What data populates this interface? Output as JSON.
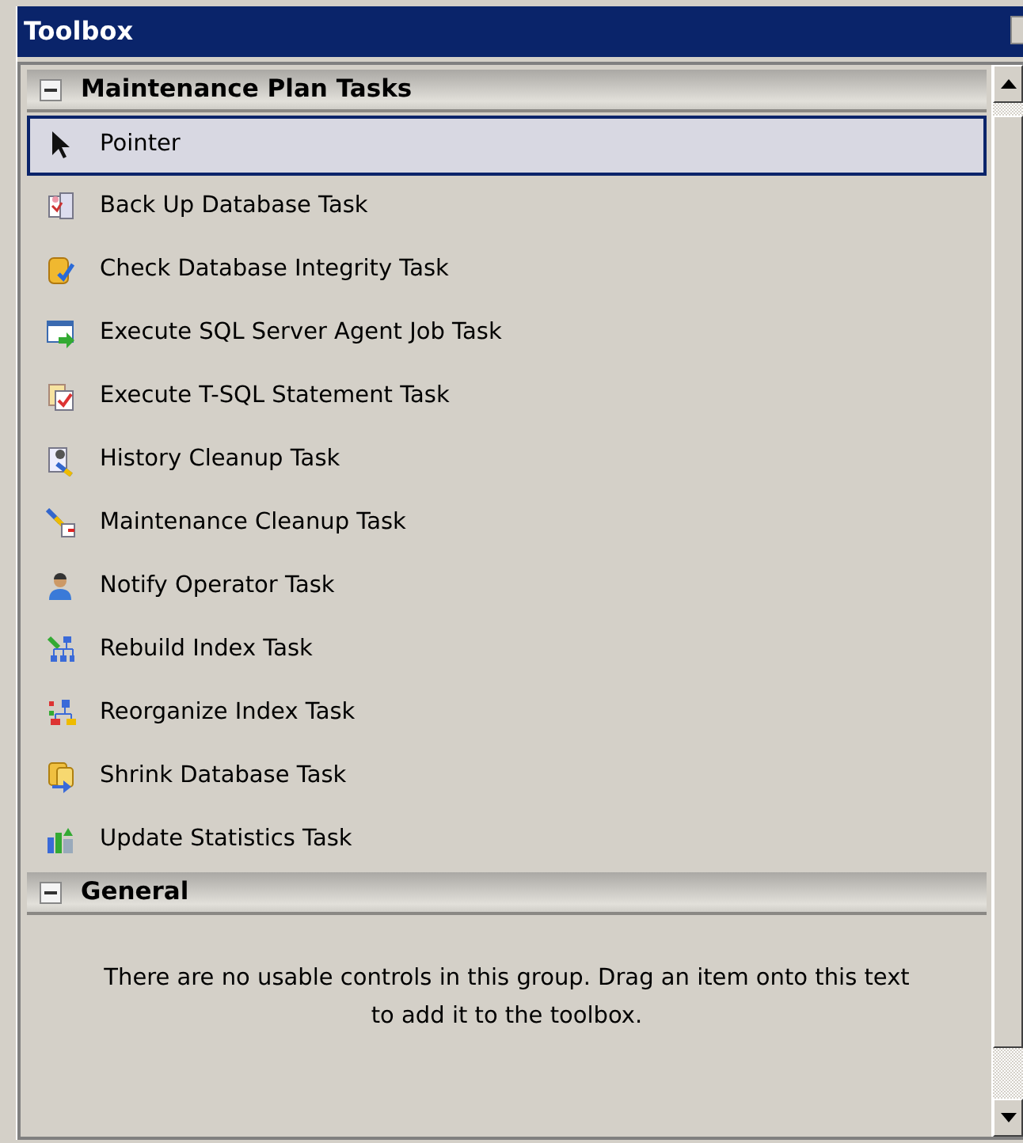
{
  "window": {
    "title": "Toolbox"
  },
  "groups": [
    {
      "name": "Maintenance Plan Tasks",
      "expanded": true,
      "items": [
        {
          "label": "Pointer",
          "selected": true
        },
        {
          "label": "Back Up Database Task",
          "selected": false
        },
        {
          "label": "Check Database Integrity Task",
          "selected": false
        },
        {
          "label": "Execute SQL Server Agent Job Task",
          "selected": false
        },
        {
          "label": "Execute T-SQL Statement Task",
          "selected": false
        },
        {
          "label": "History Cleanup Task",
          "selected": false
        },
        {
          "label": "Maintenance Cleanup Task",
          "selected": false
        },
        {
          "label": "Notify Operator Task",
          "selected": false
        },
        {
          "label": "Rebuild Index Task",
          "selected": false
        },
        {
          "label": "Reorganize Index Task",
          "selected": false
        },
        {
          "label": "Shrink Database Task",
          "selected": false
        },
        {
          "label": "Update Statistics Task",
          "selected": false
        }
      ]
    },
    {
      "name": "General",
      "expanded": true,
      "empty_message": "There are no usable controls in this group. Drag an item onto this text to add it to the toolbox."
    }
  ]
}
